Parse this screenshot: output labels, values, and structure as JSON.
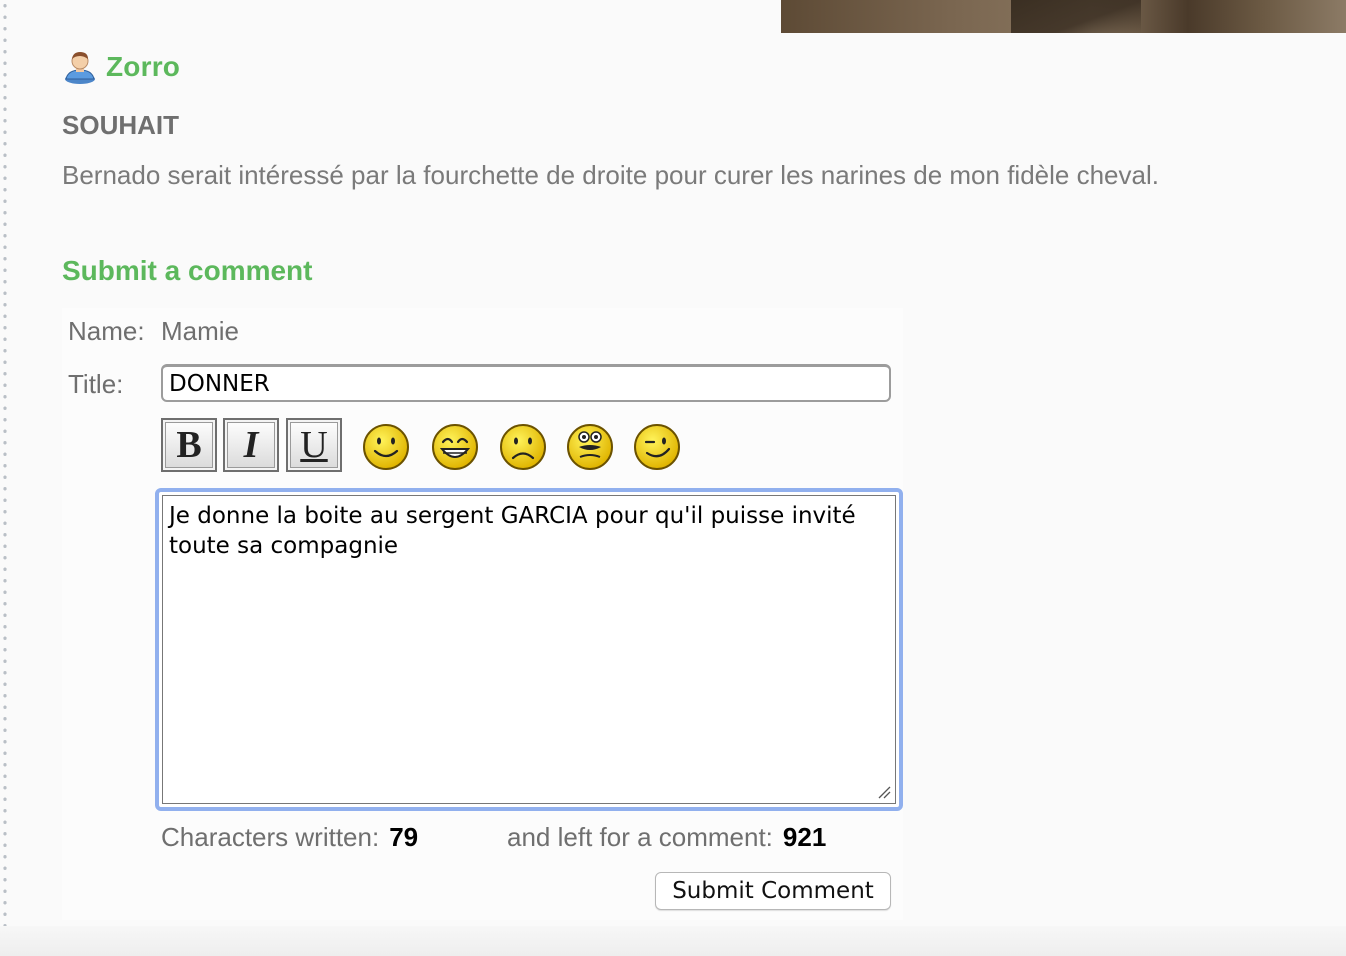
{
  "post": {
    "author": "Zorro",
    "type_label": "SOUHAIT",
    "body": "Bernado serait intéressé par la fourchette de droite pour curer les narines de mon fidèle cheval."
  },
  "comment_form": {
    "section_title": "Submit a comment",
    "name_label": "Name:",
    "name_value": "Mamie",
    "title_label": "Title:",
    "title_value": "DONNER",
    "format_buttons": {
      "bold": "B",
      "italic": "I",
      "underline": "U"
    },
    "smileys": [
      "smile-icon",
      "grin-icon",
      "sad-icon",
      "surprised-icon",
      "wink-icon"
    ],
    "comment_text": "Je donne la boite au sergent GARCIA pour qu'il puisse invité toute sa compagnie",
    "chars_written_label": "Characters written:",
    "chars_written": "79",
    "chars_left_label": "and left for a comment:",
    "chars_left": "921",
    "submit_label": "Submit Comment"
  },
  "colors": {
    "accent_green": "#5cb85c",
    "text_gray": "#6f6f6f",
    "focus_blue": "#91b0ee"
  }
}
